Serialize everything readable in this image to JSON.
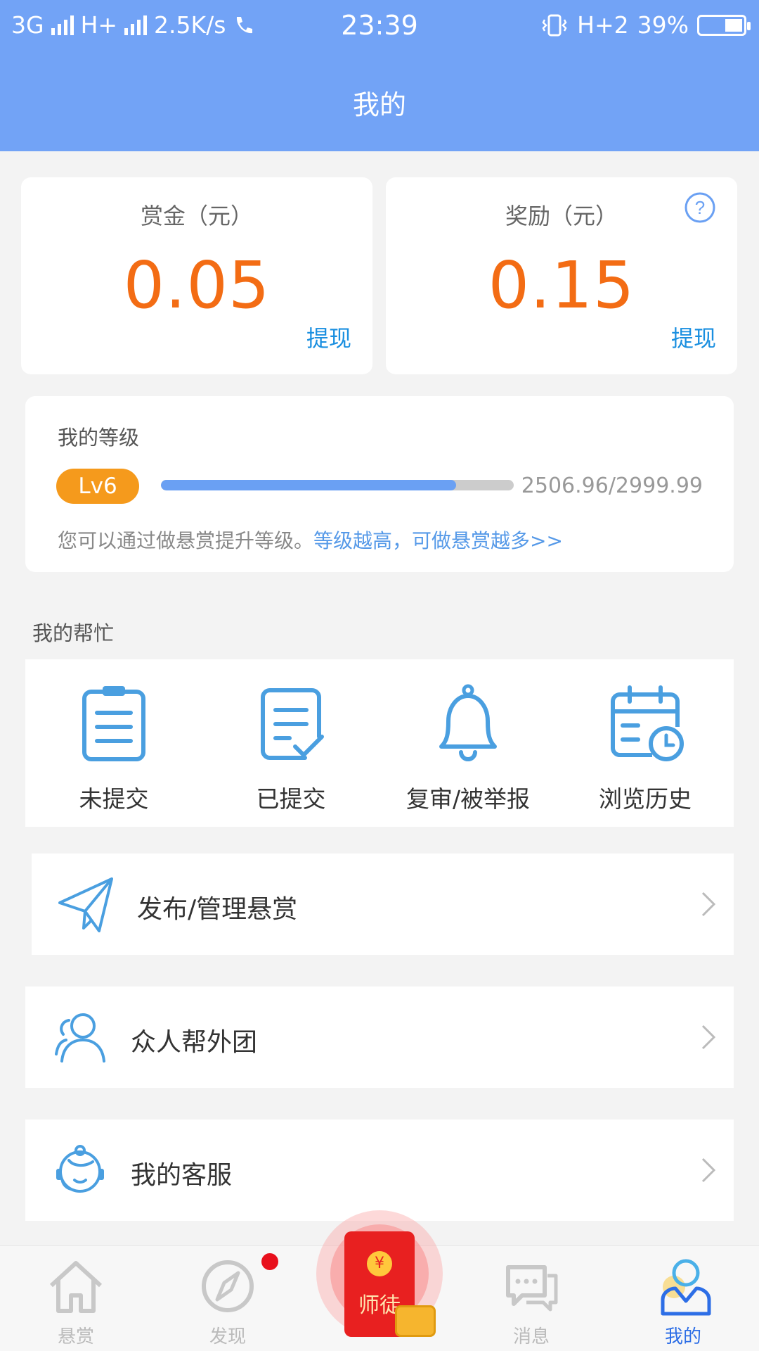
{
  "status_bar": {
    "network1": "3G",
    "network2": "H+",
    "speed": "2.5K/s",
    "time": "23:39",
    "network3": "H+2",
    "battery": "39%",
    "battery_level": 0.39
  },
  "header": {
    "title": "我的"
  },
  "wallet": {
    "bounty_label": "赏金（元）",
    "bounty_value": "0.05",
    "bounty_action": "提现",
    "reward_label": "奖励（元）",
    "reward_value": "0.15",
    "reward_action": "提现",
    "help_symbol": "?"
  },
  "level": {
    "title": "我的等级",
    "badge": "Lv6",
    "progress_text": "2506.96/2999.99",
    "progress_fraction": 0.8357,
    "desc": "您可以通过做悬赏提升等级。",
    "link": "等级越高，可做悬赏越多>>"
  },
  "help_section": {
    "title": "我的帮忙",
    "items": [
      {
        "label": "未提交",
        "icon": "clipboard-icon"
      },
      {
        "label": "已提交",
        "icon": "document-check-icon"
      },
      {
        "label": "复审/被举报",
        "icon": "bell-icon"
      },
      {
        "label": "浏览历史",
        "icon": "calendar-clock-icon"
      }
    ]
  },
  "menu": [
    {
      "label": "发布/管理悬赏",
      "icon": "paper-plane-icon"
    },
    {
      "label": "众人帮外团",
      "icon": "users-icon"
    },
    {
      "label": "我的客服",
      "icon": "customer-service-icon"
    }
  ],
  "tabbar": {
    "tabs": [
      {
        "label": "悬赏",
        "icon": "home-icon"
      },
      {
        "label": "发现",
        "icon": "compass-icon"
      },
      {
        "label": "消息",
        "icon": "message-icon"
      },
      {
        "label": "我的",
        "icon": "profile-icon"
      }
    ],
    "center": {
      "label": "师徒",
      "coin_symbol": "¥"
    },
    "colors": {
      "active": "#2d6ee6",
      "inactive": "#bbbbbb"
    }
  },
  "colors": {
    "header": "#72a3f6",
    "amount": "#f36c14",
    "link": "#1a8fe0",
    "badge": "#f59a1c",
    "progress": "#6aa0f3"
  }
}
